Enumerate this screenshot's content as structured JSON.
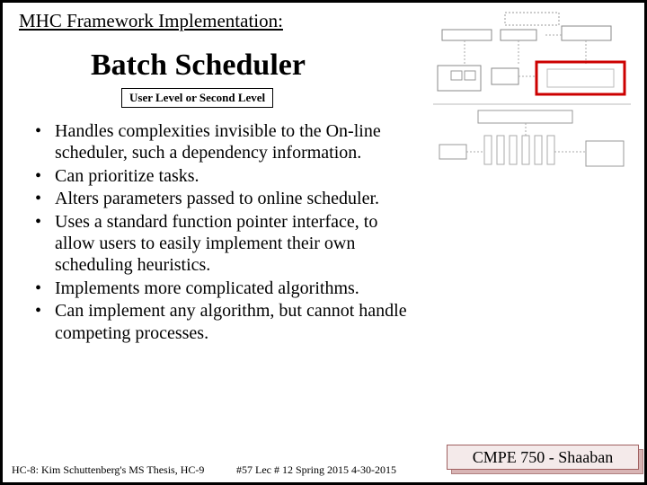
{
  "header": {
    "title": "MHC Framework Implementation:"
  },
  "main": {
    "title": "Batch Scheduler",
    "subtitle": "User Level or Second Level"
  },
  "bullets": [
    "Handles complexities invisible to the On-line scheduler, such a dependency information.",
    "Can prioritize tasks.",
    "Alters parameters passed to online scheduler.",
    "Uses a standard function pointer interface, to allow users to easily implement their own scheduling heuristics.",
    "Implements more complicated algorithms.",
    "Can implement any algorithm, but cannot handle competing processes."
  ],
  "footer": {
    "left": "HC-8: Kim Schuttenberg's MS Thesis, HC-9",
    "center": "#57   Lec # 12   Spring 2015  4-30-2015"
  },
  "course": {
    "label": "CMPE 750 - Shaaban"
  }
}
